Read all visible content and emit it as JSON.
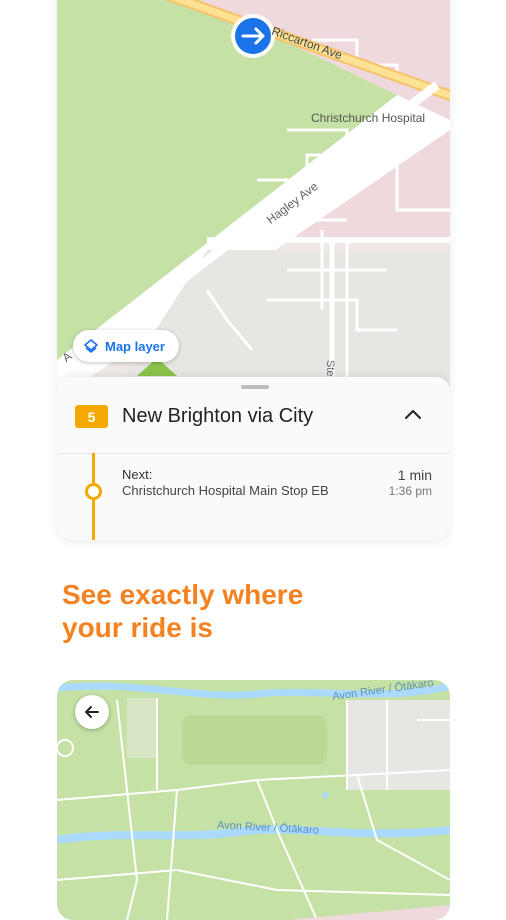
{
  "top_map": {
    "streets": {
      "riccarton": "Riccarton Ave",
      "hagley": "Hagley Ave",
      "partial_a": "A",
      "partial_stev": "Stev"
    },
    "poi": "Christchurch Hospital",
    "map_layer_label": "Map layer"
  },
  "route_panel": {
    "route_number": "5",
    "route_name": "New Brighton via City",
    "next": {
      "label": "Next:",
      "stop_name": "Christchurch Hospital Main Stop EB",
      "eta": "1 min",
      "time": "1:36 pm"
    }
  },
  "headline": {
    "line1": "See exactly where",
    "line2": "your ride is"
  },
  "bottom_map": {
    "river_top": "Avon River / Ōtākaro",
    "river_mid": "Avon River / Ōtākaro"
  },
  "colors": {
    "accent_orange": "#f58220",
    "route_yellow": "#f5a800",
    "park_green": "#c5e1a5",
    "water_blue": "#aadaff",
    "vehicle_blue": "#1a73e8"
  }
}
